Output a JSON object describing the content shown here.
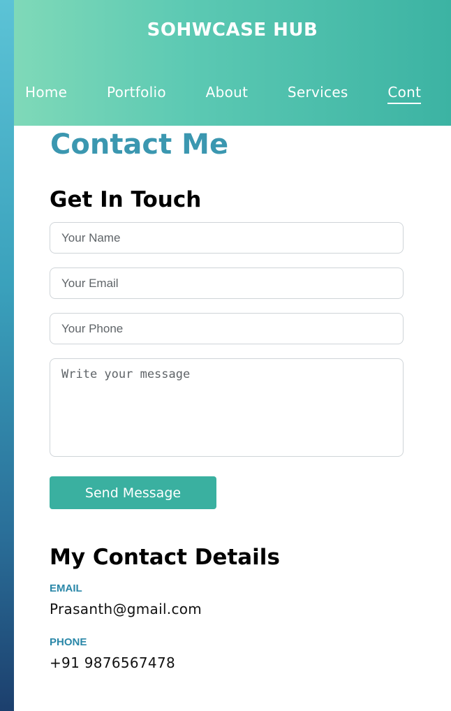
{
  "header": {
    "brand": "SOHWCASE HUB",
    "nav": [
      "Home",
      "Portfolio",
      "About",
      "Services",
      "Cont"
    ]
  },
  "main": {
    "page_title": "Contact Me",
    "form": {
      "title": "Get In Touch",
      "name_placeholder": "Your Name",
      "email_placeholder": "Your Email",
      "phone_placeholder": "Your Phone",
      "message_placeholder": "Write your message",
      "submit_label": "Send Message"
    },
    "details": {
      "title": "My Contact Details",
      "email_label": "EMAIL",
      "email_value": "Prasanth@gmail.com",
      "phone_label": "PHONE",
      "phone_value": "+91 9876567478"
    }
  },
  "colors": {
    "accent": "#3ab0a0",
    "title": "#3b97b0",
    "label": "#2a87a8"
  }
}
